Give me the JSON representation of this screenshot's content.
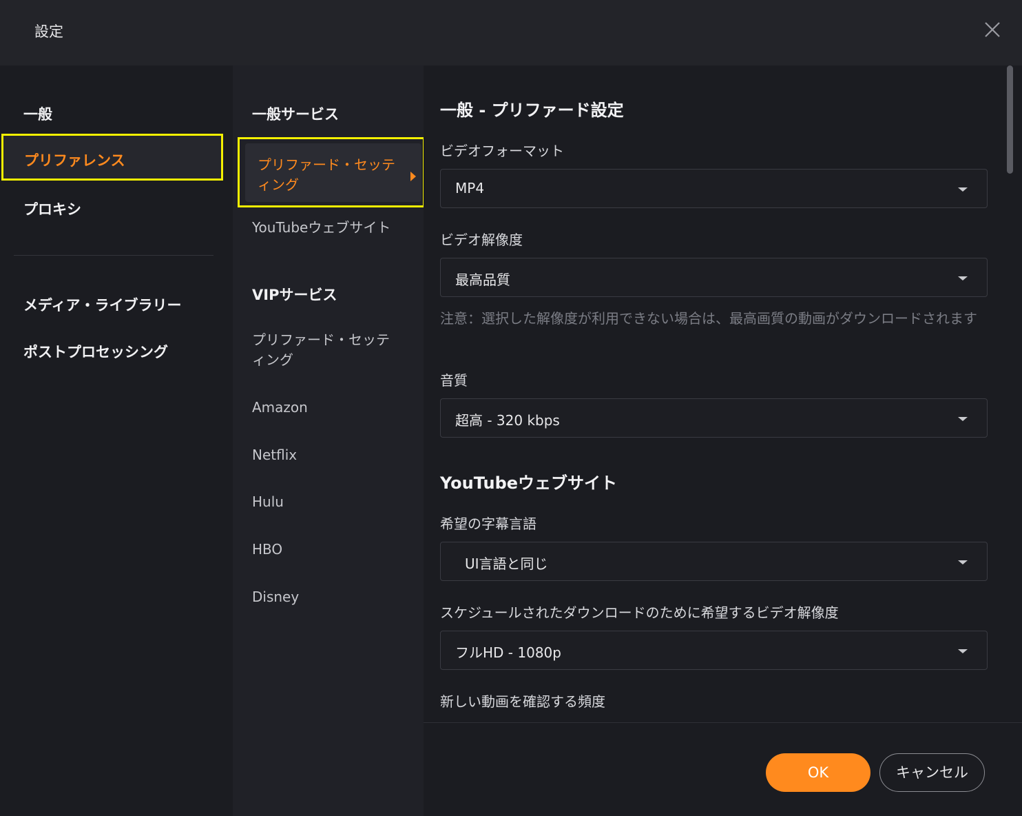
{
  "window": {
    "title": "設定",
    "close_icon": "close-icon"
  },
  "sidebar": {
    "items": [
      {
        "label": "一般"
      },
      {
        "label": "プリファレンス",
        "active": true
      },
      {
        "label": "プロキシ"
      },
      {
        "label": "メディア・ライブラリー"
      },
      {
        "label": "ポストプロセッシング"
      }
    ]
  },
  "subnav": {
    "general_header": "一般サービス",
    "general_items": [
      {
        "label": "プリファード・セッティング",
        "active": true
      },
      {
        "label": "YouTubeウェブサイト"
      }
    ],
    "vip_header": "VIPサービス",
    "vip_items": [
      {
        "label": "プリファード・セッティング"
      },
      {
        "label": "Amazon"
      },
      {
        "label": "Netflix"
      },
      {
        "label": "Hulu"
      },
      {
        "label": "HBO"
      },
      {
        "label": "Disney"
      }
    ]
  },
  "content": {
    "section1_title": "一般 - プリファード設定",
    "video_format": {
      "label": "ビデオフォーマット",
      "value": "MP4"
    },
    "video_resolution": {
      "label": "ビデオ解像度",
      "value": "最高品質"
    },
    "note": "注意：選択した解像度が利用できない場合は、最高画質の動画がダウンロードされます",
    "audio_quality": {
      "label": "音質",
      "value": "超高 - 320 kbps"
    },
    "section2_title": "YouTubeウェブサイト",
    "subtitle_language": {
      "label": "希望の字幕言語",
      "value": "UI言語と同じ"
    },
    "scheduled_resolution": {
      "label": "スケジュールされたダウンロードのために希望するビデオ解像度",
      "value": "フルHD - 1080p"
    },
    "check_frequency": {
      "label": "新しい動画を確認する頻度"
    }
  },
  "footer": {
    "ok_label": "OK",
    "cancel_label": "キャンセル"
  },
  "colors": {
    "accent": "#ff8a1e",
    "highlight_box": "#f5f100",
    "background": "#1b1c21"
  }
}
